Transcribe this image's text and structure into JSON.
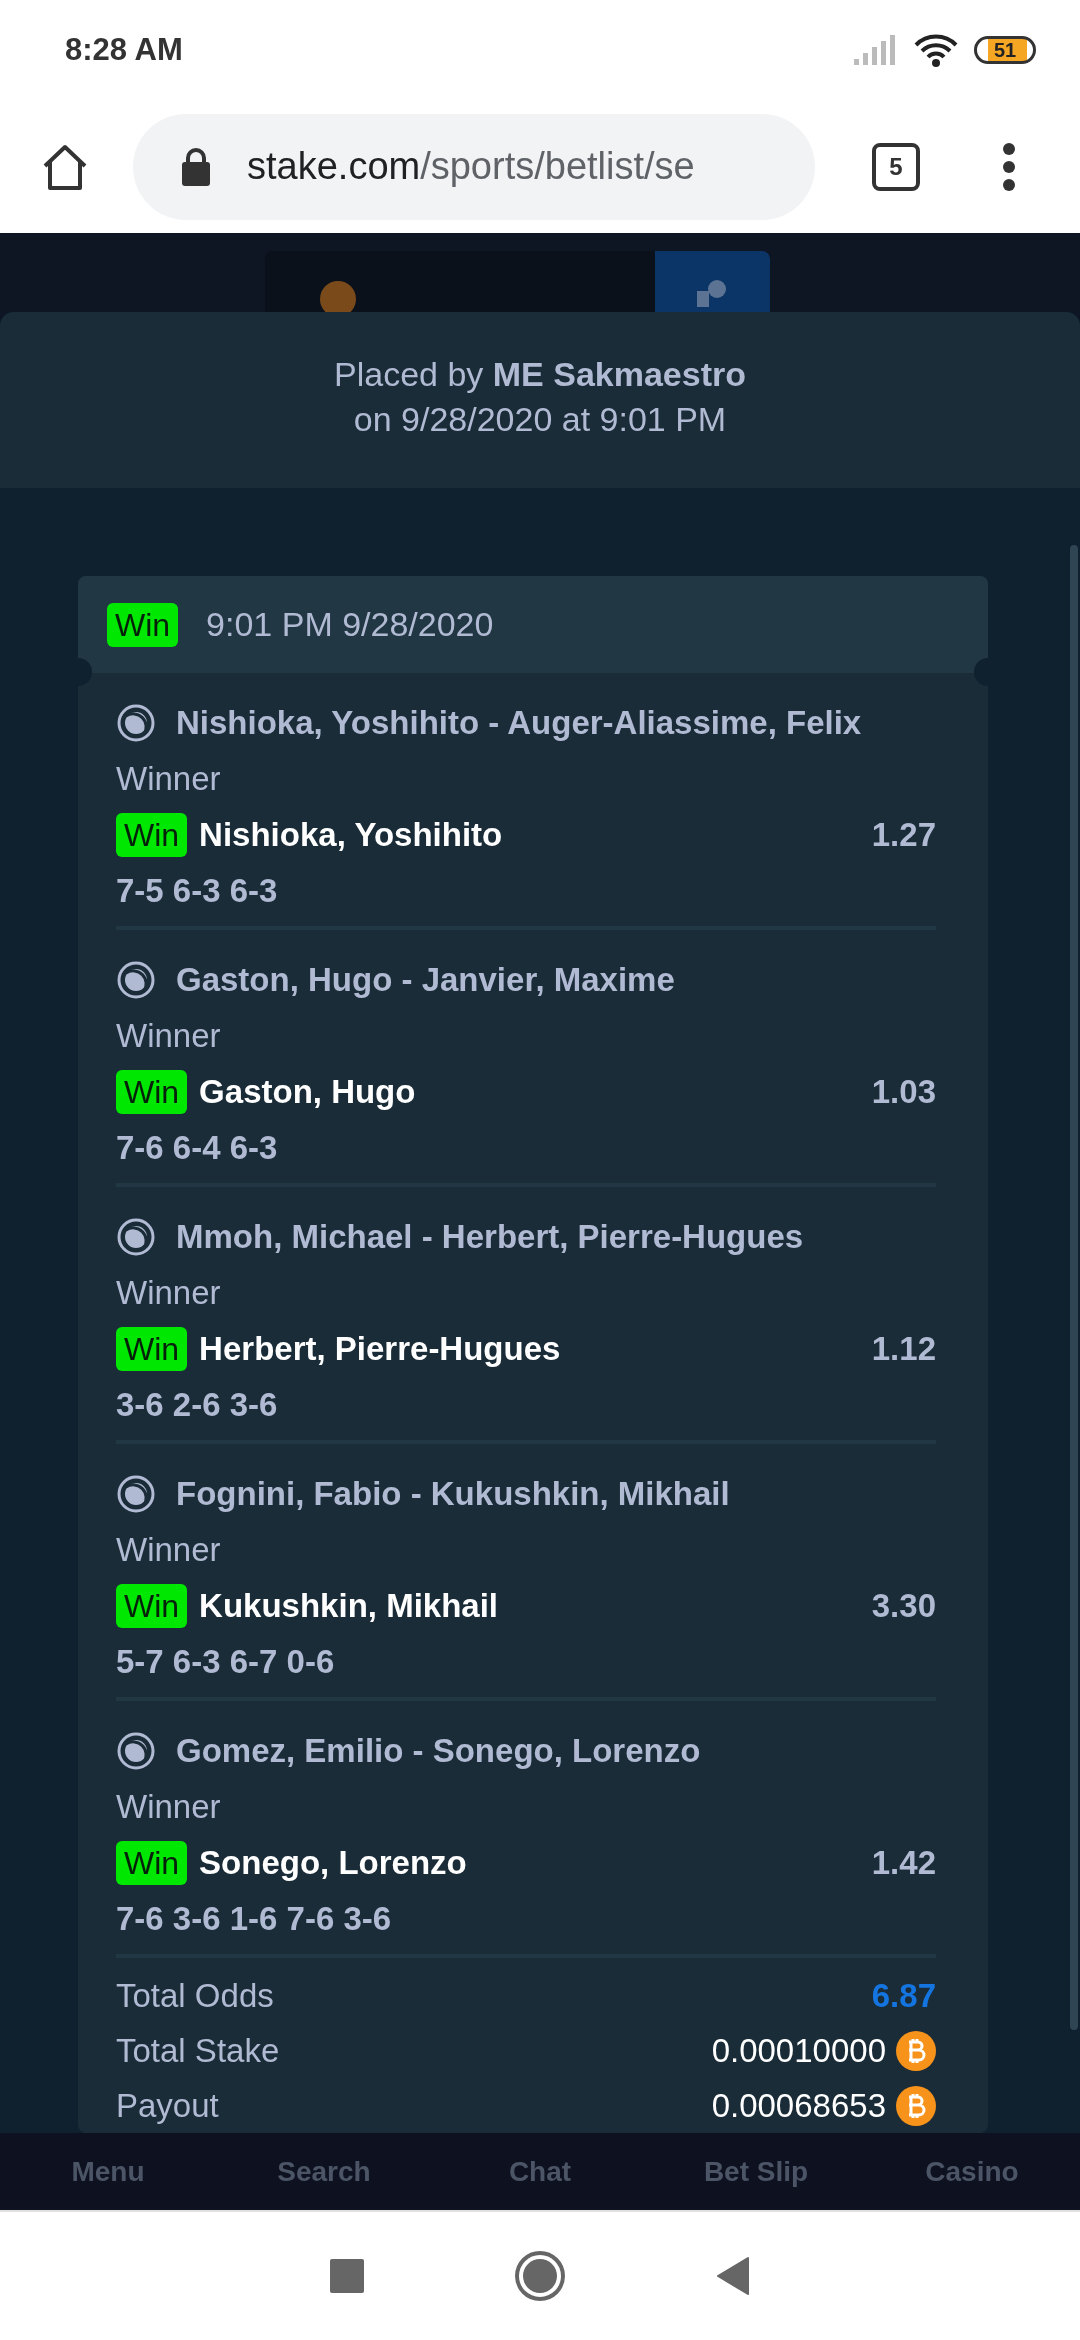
{
  "status_bar": {
    "time": "8:28 AM",
    "battery": "51"
  },
  "browser": {
    "url_host": "stake.com",
    "url_path": "/sports/betlist/se",
    "tab_count": "5"
  },
  "bet": {
    "placed_by": "Placed by **ME Sakmaestro**",
    "placed_on": "on 9/28/2020 at 9:01 PM",
    "ticket": {
      "status": "Win",
      "time": "9:01 PM 9/28/2020"
    },
    "legs": [
      {
        "event": "Nishioka, Yoshihito - Auger-Aliassime, Felix",
        "market": "Winner",
        "status": "Win",
        "pick": "Nishioka, Yoshihito",
        "odds": "1.27",
        "score": "7-5 6-3 6-3"
      },
      {
        "event": "Gaston, Hugo - Janvier, Maxime",
        "market": "Winner",
        "status": "Win",
        "pick": "Gaston, Hugo",
        "odds": "1.03",
        "score": "7-6 6-4 6-3"
      },
      {
        "event": "Mmoh, Michael - Herbert, Pierre-Hugues",
        "market": "Winner",
        "status": "Win",
        "pick": "Herbert, Pierre-Hugues",
        "odds": "1.12",
        "score": "3-6 2-6 3-6"
      },
      {
        "event": "Fognini, Fabio - Kukushkin, Mikhail",
        "market": "Winner",
        "status": "Win",
        "pick": "Kukushkin, Mikhail",
        "odds": "3.30",
        "score": "5-7 6-3 6-7 0-6"
      },
      {
        "event": "Gomez, Emilio - Sonego, Lorenzo",
        "market": "Winner",
        "status": "Win",
        "pick": "Sonego, Lorenzo",
        "odds": "1.42",
        "score": "7-6 3-6 1-6 7-6 3-6"
      }
    ],
    "totals": [
      {
        "label": "Total Odds",
        "value": "6.87",
        "kind": "odds"
      },
      {
        "label": "Total Stake",
        "value": "0.00010000",
        "kind": "amount"
      },
      {
        "label": "Payout",
        "value": "0.00068653",
        "kind": "amount"
      }
    ]
  },
  "bottom_nav": [
    {
      "label": "Menu"
    },
    {
      "label": "Search"
    },
    {
      "label": "Chat"
    },
    {
      "label": "Bet Slip"
    },
    {
      "label": "Casino"
    }
  ]
}
